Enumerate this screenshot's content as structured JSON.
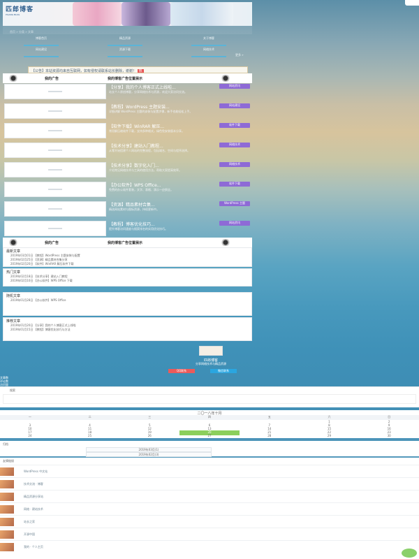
{
  "header": {
    "logo_cn": "匹郎博客",
    "logo_en": "PILANG BLOG"
  },
  "breadcrumb": "首页 » 分类 » 文章",
  "nav": {
    "row1": [
      "博客首页",
      "精品资源",
      "关于博客"
    ],
    "row2": [
      "网站建设",
      "资源下载",
      "网络技术"
    ],
    "more": "更多 »"
  },
  "notice": {
    "text": "【公告】本站资源均来自互联网，如有侵权请联系站长删除，谢谢！",
    "hot": "热"
  },
  "ad": {
    "left_label": "我的广告",
    "center_label": "我的博客广告位置展示"
  },
  "posts": [
    {
      "title": "【分享】我的个人博客正式上线啦...",
      "tag": "网站资讯",
      "desc": "站长个人原创博客，分享网络技术与资源，欢迎大家访问交流。"
    },
    {
      "title": "【教程】WordPress 主题安装...",
      "tag": "网站建设",
      "desc": "详细讲解 WordPress 主题的安装与配置步骤，新手也能轻松上手。"
    },
    {
      "title": "【软件下载】WinRAR 解压...",
      "tag": "软件下载",
      "desc": "常用解压缩软件下载，支持多种格式，绿色免安装版本分享。"
    },
    {
      "title": "【技术分享】建站入门教程...",
      "tag": "网络技术",
      "desc": "从零开始搭建个人网站的完整流程，包括域名、空间与程序选择。"
    },
    {
      "title": "【技术分享】数字化入门...",
      "tag": "网络技术",
      "desc": "介绍常见网络技术与工具的使用方法，帮助大家提高效率。"
    },
    {
      "title": "【办公软件】WPS Office...",
      "tag": "软件下载",
      "desc": "免费的办公软件套装，文字、表格、演示一应俱全。"
    },
    {
      "title": "【资源】精品素材合集...",
      "tag": "WordPress 主题",
      "desc": "精选网站素材与图标资源，持续更新中。"
    },
    {
      "title": "【教程】博客优化技巧...",
      "tag": "网站资讯",
      "desc": "提升博客访问速度与搜索排名的实用优化技巧。"
    }
  ],
  "widgets": {
    "recent": {
      "title": "最新文章",
      "items": [
        "2019年03月01日 【教程】WordPress 主题安装与配置",
        "2019年02月25日 【资源】精品素材合集分享",
        "2019年02月20日 【软件】WinRAR 解压软件下载"
      ]
    },
    "popular": {
      "title": "热门文章",
      "items": [
        "2019年02月18日 【技术分享】建站入门教程",
        "2019年02月10日 【办公软件】WPS Office 下载"
      ]
    },
    "random": {
      "title": "随机文章",
      "items": [
        "2019年01月28日 【办公软件】WPS Office"
      ]
    },
    "recommend": {
      "title": "推荐文章",
      "items": [
        "2019年01月20日 【分享】我的个人博客正式上线啦",
        "2019年01月15日 【教程】博客优化技巧与方法"
      ]
    }
  },
  "author": {
    "name": "匹郎博客",
    "sub": "分享网络技术与精品资源",
    "btn_qq": "QQ联系",
    "btn_wx": "微信联系"
  },
  "stats": [
    "文章数",
    "评论数",
    "访问量"
  ],
  "search": {
    "label": "搜索"
  },
  "calendar": {
    "title": "二〇一八年十月",
    "weekdays": [
      "一",
      "二",
      "三",
      "四",
      "五",
      "六",
      "日"
    ],
    "rows": [
      [
        "",
        "",
        "",
        "",
        "",
        "1",
        "2"
      ],
      [
        "3",
        "4",
        "5",
        "6",
        "7",
        "8",
        "9"
      ],
      [
        "10",
        "11",
        "12",
        "13",
        "14",
        "15",
        "16"
      ],
      [
        "17",
        "18",
        "19",
        "20",
        "21",
        "22",
        "23"
      ],
      [
        "24",
        "25",
        "26",
        "27",
        "28",
        "29",
        "30"
      ]
    ],
    "today": "20"
  },
  "archive": {
    "title": "归档",
    "items": [
      "2019年03月(1)",
      "2019年02月(3)"
    ]
  },
  "links": {
    "title": "友情链接",
    "items": [
      "WordPress 中文站",
      "技术交流 · 博客",
      "精品资源分享站",
      "网络 · 建站技术",
      "站长之家",
      "开源中国",
      "我的 · 个人主页"
    ]
  },
  "colors": {
    "accent": "#8e6ad6",
    "qq": "#ec5a5a",
    "wechat": "#2aa6e0",
    "today": "#8ccf5c"
  }
}
